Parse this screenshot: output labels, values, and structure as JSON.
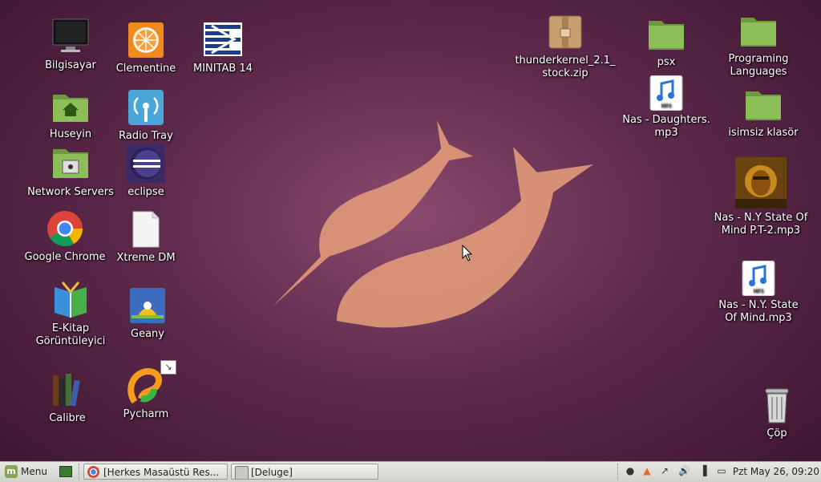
{
  "desktop": {
    "icons": [
      {
        "label": "Bilgisayar",
        "icon": "computer-icon"
      },
      {
        "label": "Clementine",
        "icon": "clementine-icon"
      },
      {
        "label": "MINITAB 14",
        "icon": "minitab-icon"
      },
      {
        "label": "Huseyin",
        "icon": "home-folder-icon"
      },
      {
        "label": "Radio Tray",
        "icon": "radio-tray-icon"
      },
      {
        "label": "Network Servers",
        "icon": "network-folder-icon"
      },
      {
        "label": "eclipse",
        "icon": "eclipse-icon"
      },
      {
        "label": "Google Chrome",
        "icon": "chrome-icon"
      },
      {
        "label": "Xtreme DM",
        "icon": "document-icon"
      },
      {
        "label": "E-Kitap Görüntüleyici",
        "icon": "ebook-icon"
      },
      {
        "label": "Geany",
        "icon": "geany-icon"
      },
      {
        "label": "Calibre",
        "icon": "calibre-icon"
      },
      {
        "label": "Pycharm",
        "icon": "pycharm-icon"
      },
      {
        "label": "thunderkernel_2.1_ stock.zip",
        "icon": "zip-archive-icon"
      },
      {
        "label": "psx",
        "icon": "folder-icon"
      },
      {
        "label": "Programing Languages",
        "icon": "folder-icon"
      },
      {
        "label": "Nas - Daughters. mp3",
        "icon": "mp3-file-icon"
      },
      {
        "label": "isimsiz klasör",
        "icon": "folder-icon"
      },
      {
        "label": "Nas - N.Y State Of Mind P.T-2.mp3",
        "icon": "album-art-icon"
      },
      {
        "label": "Nas - N.Y. State Of Mind.mp3",
        "icon": "mp3-file-icon"
      },
      {
        "label": "Çöp",
        "icon": "trash-icon"
      }
    ]
  },
  "taskbar": {
    "menu_label": "Menu",
    "tasks": [
      {
        "label": "[Herkes Masaüstü Res...",
        "icon": "chrome-icon"
      },
      {
        "label": "[Deluge]",
        "icon": "deluge-icon"
      }
    ],
    "clock": "Pzt May 26, 09:20"
  },
  "colors": {
    "accent": "#87a556",
    "wallpaper": "#5e2a4c",
    "narwhal": "#e8a07a"
  }
}
